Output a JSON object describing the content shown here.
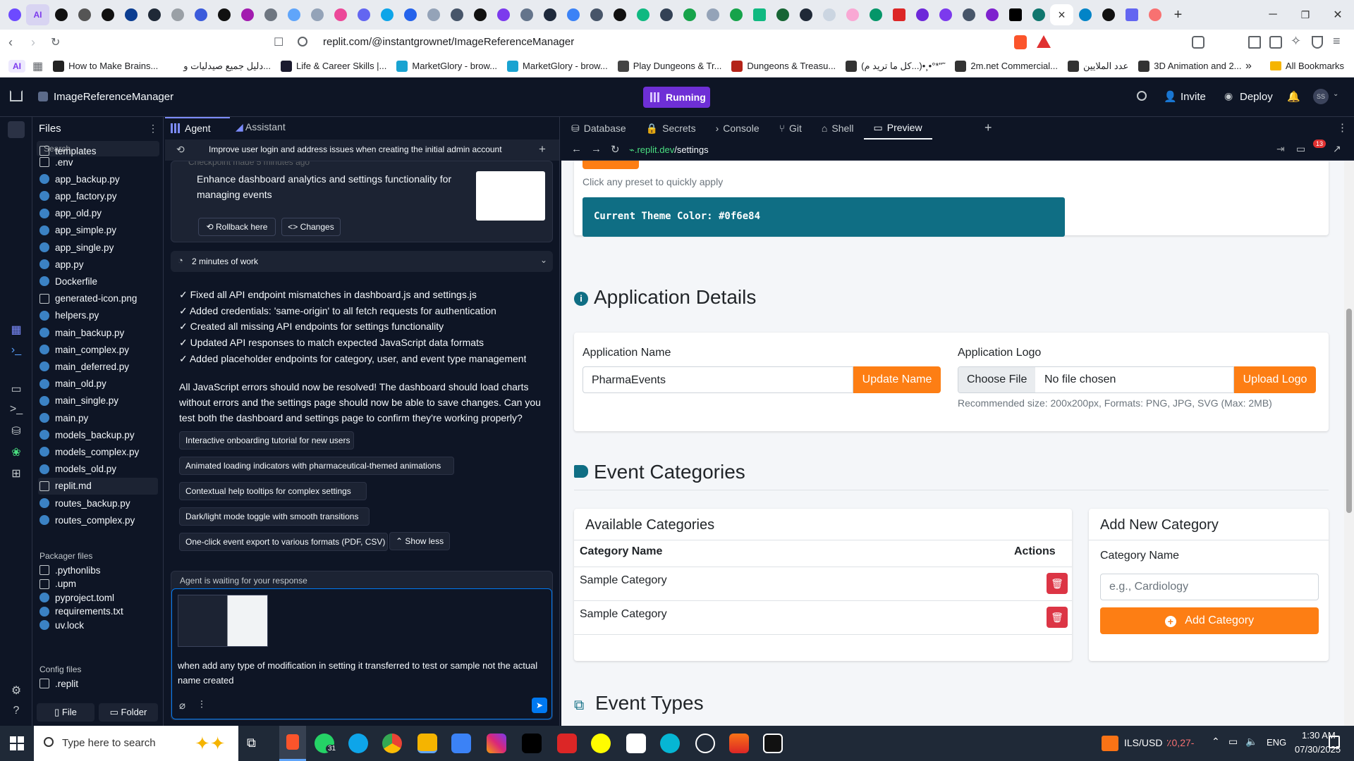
{
  "browser": {
    "url": "replit.com/@instantgrownet/ImageReferenceManager",
    "tab_close": "×",
    "bookmarks": [
      {
        "label": "How to Make Brains...",
        "color": "#222"
      },
      {
        "label": "دليل جميع صيدليات و...",
        "color": "#fff"
      },
      {
        "label": "Life & Career Skills |...",
        "color": "#1a1a2e"
      },
      {
        "label": "MarketGlory - brow...",
        "color": "#19a3d1"
      },
      {
        "label": "MarketGlory - brow...",
        "color": "#19a3d1"
      },
      {
        "label": "Play Dungeons & Tr...",
        "color": "#444"
      },
      {
        "label": "Dungeons & Treasu...",
        "color": "#b42318"
      },
      {
        "label": "(كل ما تريد م...)•¸•°*\"˜",
        "color": "#333"
      },
      {
        "label": "2m.net Commercial...",
        "color": "#333"
      },
      {
        "label": "عدد الملايين",
        "color": "#333"
      },
      {
        "label": "3D Animation and 2...",
        "color": "#333"
      }
    ],
    "all_bookmarks": "All Bookmarks",
    "ai_badge": "AI"
  },
  "header": {
    "project": "ImageReferenceManager",
    "run_label": "Running",
    "invite": "Invite",
    "deploy": "Deploy",
    "avatar": "SS"
  },
  "files": {
    "title": "Files",
    "search_placeholder": "Search",
    "items": [
      "templates",
      ".env",
      "app_backup.py",
      "app_factory.py",
      "app_old.py",
      "app_simple.py",
      "app_single.py",
      "app.py",
      "Dockerfile",
      "generated-icon.png",
      "helpers.py",
      "main_backup.py",
      "main_complex.py",
      "main_deferred.py",
      "main_old.py",
      "main_single.py",
      "main.py",
      "models_backup.py",
      "models_complex.py",
      "models_old.py",
      "replit.md",
      "routes_backup.py",
      "routes_complex.py"
    ],
    "packager_title": "Packager files",
    "packager_items": [
      ".pythonlibs",
      ".upm",
      "pyproject.toml",
      "requirements.txt",
      "uv.lock"
    ],
    "config_title": "Config files",
    "config_items": [
      ".replit"
    ],
    "new_file": "File",
    "new_folder": "Folder"
  },
  "agent": {
    "tab_agent": "Agent",
    "tab_assistant": "Assistant",
    "thread_title": "Improve user login and address issues when creating the initial admin account",
    "checkpoint": "Checkpoint made 5 minutes ago",
    "checkpoint_msg": "Enhance dashboard analytics and settings functionality for managing events",
    "rollback": "Rollback here",
    "changes": "Changes",
    "work": "2 minutes of work",
    "bullets": [
      "✓ Fixed all API endpoint mismatches in dashboard.js and settings.js",
      "✓ Added credentials: 'same-origin' to all fetch requests for authentication",
      "✓ Created all missing API endpoints for settings functionality",
      "✓ Updated API responses to match expected JavaScript data formats",
      "✓ Added placeholder endpoints for category, user, and event type management"
    ],
    "summary": "All JavaScript errors should now be resolved! The dashboard should load charts without errors and the settings page should now be able to save changes. Can you test both the dashboard and settings page to confirm they're working properly?",
    "suggestions": [
      "Interactive onboarding tutorial for new users",
      "Animated loading indicators with pharmaceutical-themed animations",
      "Contextual help tooltips for complex settings",
      "Dark/light mode toggle with smooth transitions",
      "One-click event export to various formats (PDF, CSV)"
    ],
    "show_less": "Show less",
    "waiting": "Agent is waiting for your response",
    "input_text": "when add any type of modification in setting it transferred to test or sample not the actual name created"
  },
  "tools": {
    "tabs": [
      "Database",
      "Secrets",
      "Console",
      "Git",
      "Shell",
      "Preview"
    ],
    "url_host": ".replit.dev",
    "url_path": "/settings",
    "badge": "13"
  },
  "page": {
    "preset_hint": "Click any preset to quickly apply",
    "theme_label": "Current Theme Color: #0f6e84",
    "theme_color": "#0f6e84",
    "app_details": "Application Details",
    "app_name_label": "Application Name",
    "app_name_value": "PharmaEvents",
    "update_name": "Update Name",
    "app_logo_label": "Application Logo",
    "choose_file": "Choose File",
    "no_file": "No file chosen",
    "upload_logo": "Upload Logo",
    "logo_hint": "Recommended size: 200x200px, Formats: PNG, JPG, SVG (Max: 2MB)",
    "event_categories": "Event Categories",
    "available": "Available Categories",
    "col_name": "Category Name",
    "col_actions": "Actions",
    "rows": [
      "Sample Category",
      "Sample Category"
    ],
    "add_new": "Add New Category",
    "cat_name_label": "Category Name",
    "cat_placeholder": "e.g., Cardiology",
    "add_category": "Add Category",
    "event_types": "Event Types",
    "accent": "#fd7e14"
  },
  "taskbar": {
    "search": "Type here to search",
    "whatsapp_badge": "31",
    "ticker": "ILS/USD",
    "ticker_change": "٪0,27-",
    "lang": "ENG",
    "time": "1:30 AM",
    "date": "07/30/2025"
  }
}
